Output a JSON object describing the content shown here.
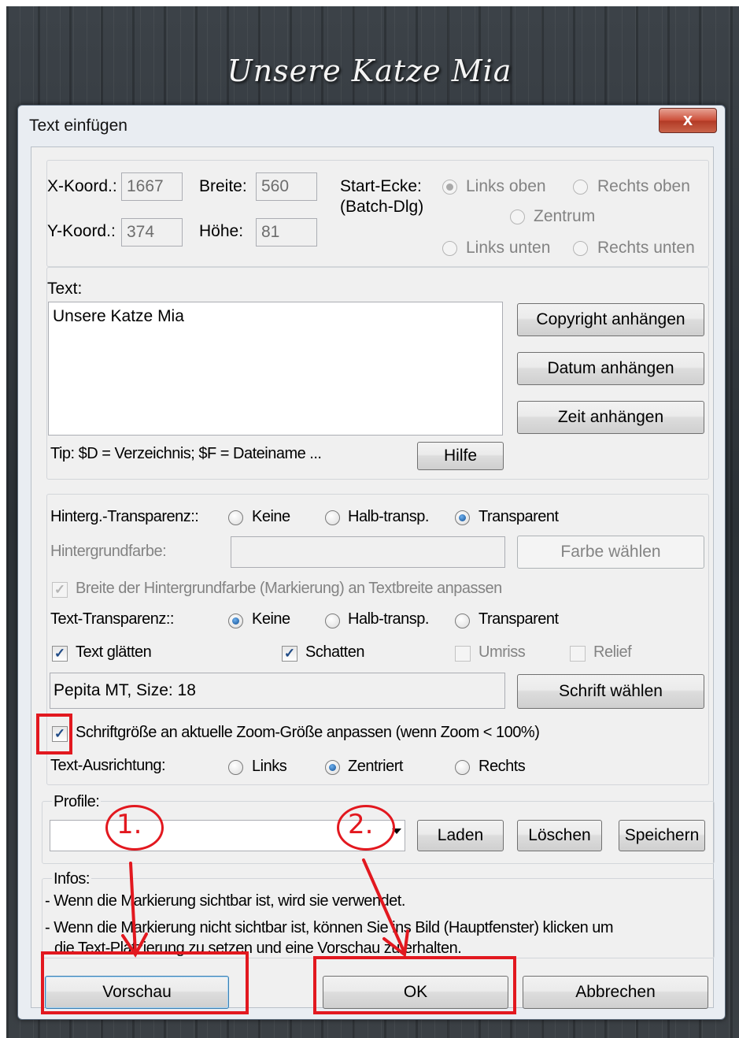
{
  "photo": {
    "title": "Unsere Katze Mia"
  },
  "dialog": {
    "title": "Text einfügen",
    "close_label": "x",
    "position": {
      "x_label": "X-Koord.:",
      "x_value": "1667",
      "y_label": "Y-Koord.:",
      "y_value": "374",
      "width_label": "Breite:",
      "width_value": "560",
      "height_label": "Höhe:",
      "height_value": "81",
      "start_corner_label_1": "Start-Ecke:",
      "start_corner_label_2": "(Batch-Dlg)",
      "corners": {
        "top_left": "Links oben",
        "top_right": "Rechts oben",
        "center": "Zentrum",
        "bottom_left": "Links unten",
        "bottom_right": "Rechts unten"
      },
      "selected_corner": "top_left"
    },
    "text_section": {
      "label": "Text:",
      "value": "Unsere Katze Mia",
      "copyright_button": "Copyright anhängen",
      "date_button": "Datum anhängen",
      "time_button": "Zeit anhängen",
      "tip": "Tip: $D = Verzeichnis; $F = Dateiname ...",
      "help_button": "Hilfe"
    },
    "appearance": {
      "bg_transparency_label": "Hinterg.-Transparenz::",
      "opt_none": "Keine",
      "opt_half": "Halb-transp.",
      "opt_transparent": "Transparent",
      "bg_transparency_selected": "Transparent",
      "bg_color_label": "Hintergrundfarbe:",
      "choose_color_button": "Farbe wählen",
      "fit_width_label": "Breite der Hintergrundfarbe (Markierung) an Textbreite anpassen",
      "text_transparency_label": "Text-Transparenz::",
      "text_transparency_selected": "Keine",
      "smooth_label": "Text glätten",
      "smooth_checked": true,
      "shadow_label": "Schatten",
      "shadow_checked": true,
      "outline_label": "Umriss",
      "outline_checked": false,
      "relief_label": "Relief",
      "relief_checked": false,
      "font_value": "Pepita MT, Size: 18",
      "choose_font_button": "Schrift wählen",
      "zoom_fit_label": "Schriftgröße an aktuelle Zoom-Größe anpassen (wenn Zoom < 100%)",
      "zoom_fit_checked": true,
      "alignment_label": "Text-Ausrichtung:",
      "align_left": "Links",
      "align_center": "Zentriert",
      "align_right": "Rechts",
      "alignment_selected": "Zentriert"
    },
    "profiles": {
      "label": "Profile:",
      "selected": "",
      "load_button": "Laden",
      "delete_button": "Löschen",
      "save_button": "Speichern"
    },
    "infos": {
      "label": "Infos:",
      "line1": "- Wenn die Markierung sichtbar ist, wird sie verwendet.",
      "line2": "- Wenn die Markierung nicht sichtbar ist, können Sie ins Bild (Hauptfenster) klicken um",
      "line3": "die Text-Platzierung zu setzen und eine Vorschau zu erhalten."
    },
    "footer": {
      "preview_button": "Vorschau",
      "ok_button": "OK",
      "cancel_button": "Abbrechen"
    }
  },
  "annotations": {
    "step1": "1.",
    "step2": "2.",
    "color": "#e2181f"
  }
}
